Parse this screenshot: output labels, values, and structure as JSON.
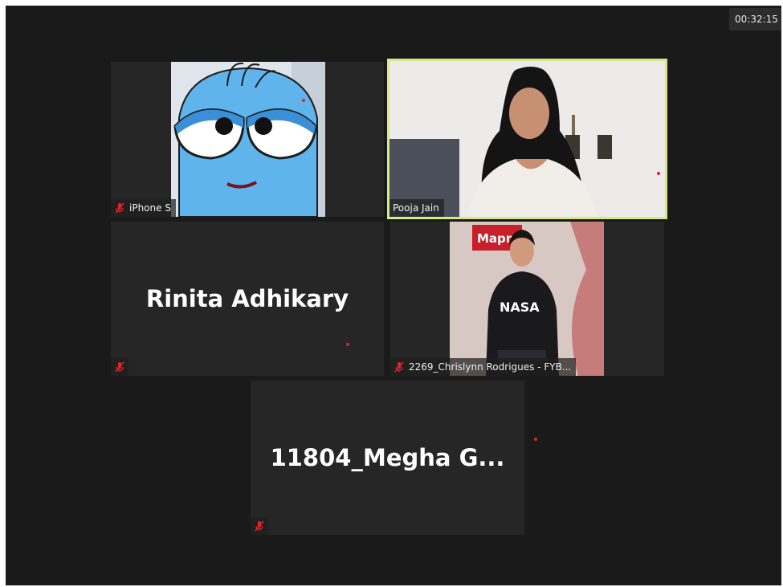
{
  "meeting": {
    "elapsed_time": "00:32:15"
  },
  "participants": [
    {
      "display_name": "iPhone S",
      "muted": true,
      "video_on": true,
      "avatar": "cartoon-bird-avatar"
    },
    {
      "display_name": "Pooja Jain",
      "muted": false,
      "video_on": true,
      "active_speaker": true
    },
    {
      "display_name": "Rinita Adhikary",
      "muted": true,
      "video_on": false
    },
    {
      "display_name": "2269_Chrislynn Rodrigues - FYB...",
      "muted": true,
      "video_on": true
    },
    {
      "display_name": "11804_Megha  G...",
      "muted": true,
      "video_on": false
    }
  ],
  "colors": {
    "active_speaker_border": "#d6e98a",
    "recording_dot": "#e0252b",
    "mute_icon": "#e0252b",
    "background": "#1a1a1a",
    "tile": "#262626"
  }
}
